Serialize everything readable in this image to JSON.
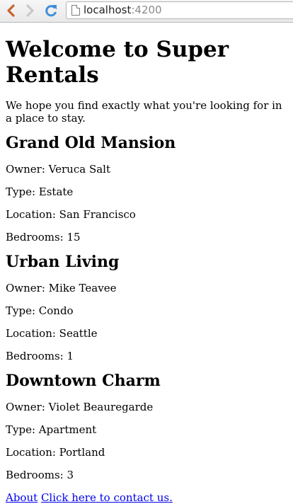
{
  "browser": {
    "url_host": "localhost",
    "url_port": ":4200"
  },
  "page": {
    "title": "Welcome to Super Rentals",
    "intro": "We hope you find exactly what you're looking for in a place to stay."
  },
  "rentals": [
    {
      "title": "Grand Old Mansion",
      "owner": "Owner: Veruca Salt",
      "type": "Type: Estate",
      "location": "Location: San Francisco",
      "bedrooms": "Bedrooms: 15"
    },
    {
      "title": "Urban Living",
      "owner": "Owner: Mike Teavee",
      "type": "Type: Condo",
      "location": "Location: Seattle",
      "bedrooms": "Bedrooms: 1"
    },
    {
      "title": "Downtown Charm",
      "owner": "Owner: Violet Beauregarde",
      "type": "Type: Apartment",
      "location": "Location: Portland",
      "bedrooms": "Bedrooms: 3"
    }
  ],
  "footer": {
    "about_link": "About",
    "contact_link": "Click here to contact us."
  },
  "icons": {
    "back": "back-arrow-icon",
    "forward": "forward-arrow-icon",
    "reload": "reload-icon",
    "page": "page-icon"
  },
  "colors": {
    "back_arrow": "#c8622e",
    "reload": "#3f8ed8",
    "link": "#0000ee"
  }
}
